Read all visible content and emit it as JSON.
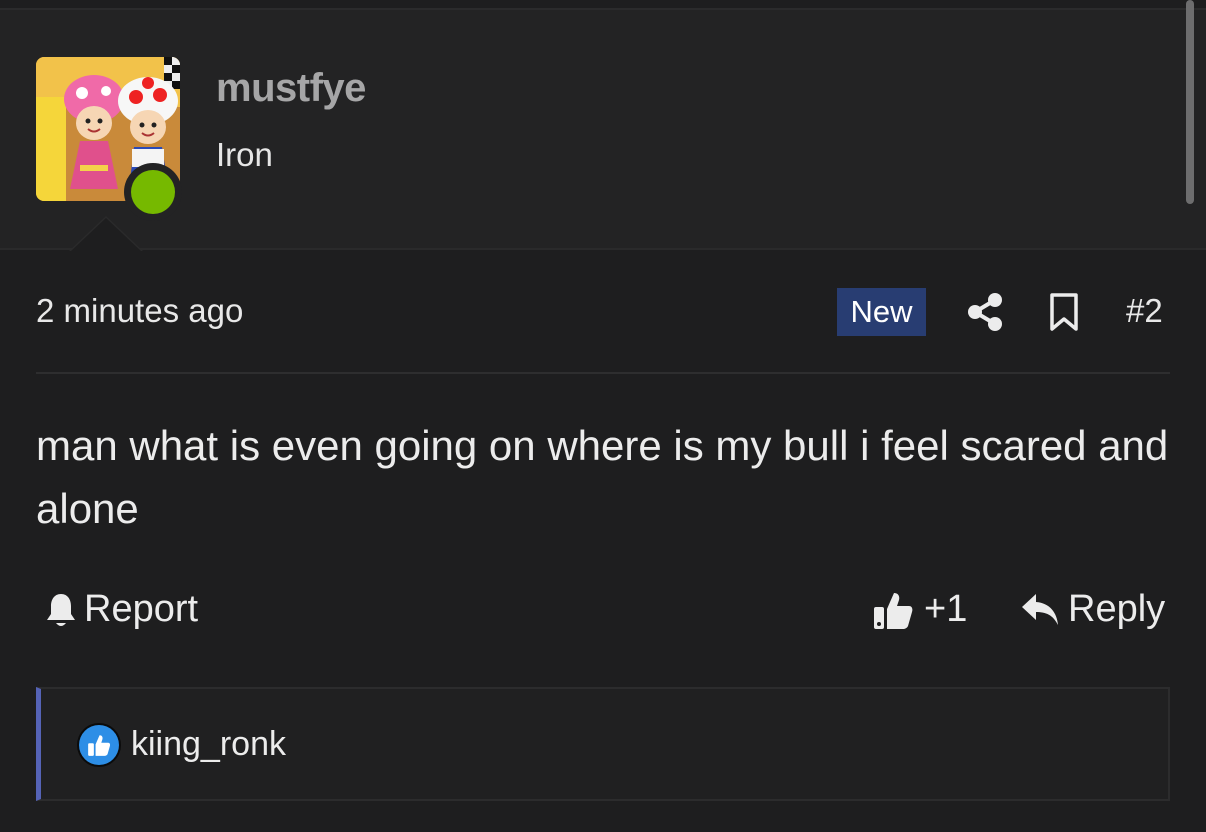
{
  "author": {
    "username": "mustfye",
    "title": "Iron",
    "online": true
  },
  "post": {
    "timestamp": "2 minutes ago",
    "badge": "New",
    "number": "#2",
    "message": "man what is even going on where is my bull i feel scared and alone"
  },
  "actions": {
    "report_label": "Report",
    "like_count": "+1",
    "reply_label": "Reply"
  },
  "reactions": {
    "users": [
      "kiing_ronk"
    ]
  },
  "colors": {
    "background": "#1e1e1f",
    "header_background": "#232324",
    "badge": "#283d72",
    "online": "#76b900",
    "reaction_accent": "#5563b6",
    "like_reaction": "#2d8ee6"
  },
  "icons": {
    "share": "share-icon",
    "bookmark": "bookmark-icon",
    "report": "bell-icon",
    "like": "thumbs-up-icon",
    "reply": "reply-arrow-icon"
  }
}
